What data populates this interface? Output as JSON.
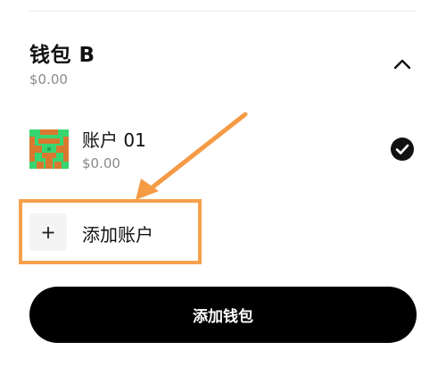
{
  "wallet": {
    "name": "钱包 B",
    "balance": "$0.00",
    "collapse_icon": "chevron-up-icon"
  },
  "accounts": [
    {
      "name": "账户 01",
      "balance": "$0.00",
      "selected": true,
      "avatar_colors": [
        "#37d670",
        "#d9782f"
      ]
    }
  ],
  "add_account": {
    "label": "添加账户",
    "icon": "plus-icon"
  },
  "add_wallet": {
    "label": "添加钱包"
  },
  "colors": {
    "highlight": "#f7a04b",
    "primary_button": "#000000",
    "secondary_text": "#8a8a8a"
  }
}
